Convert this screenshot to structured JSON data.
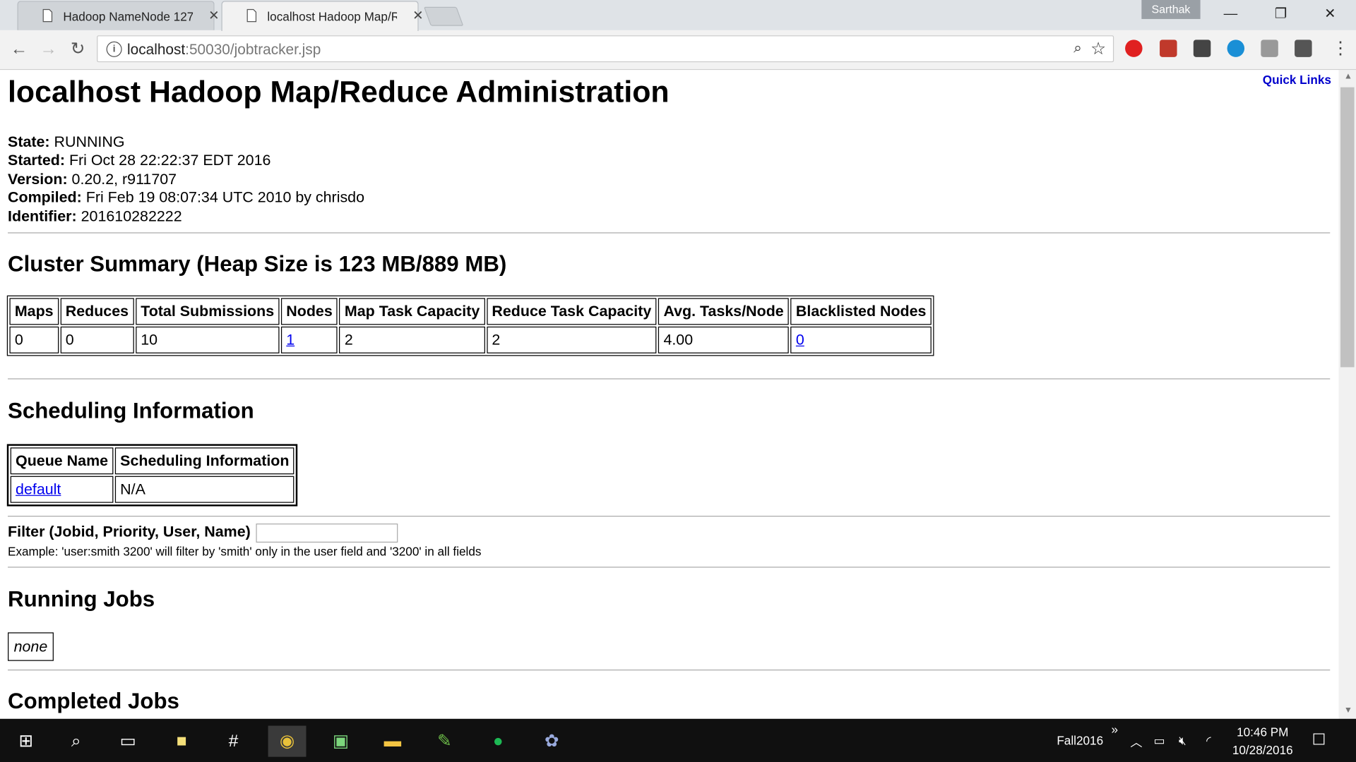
{
  "browser": {
    "tabs": [
      {
        "title": "Hadoop NameNode 127",
        "active": false
      },
      {
        "title": "localhost Hadoop Map/R",
        "active": true
      }
    ],
    "profile": "Sarthak",
    "url_host": "localhost",
    "url_rest": ":50030/jobtracker.jsp",
    "extensions": [
      "opera-icon",
      "pdf-icon",
      "pocket-icon",
      "circle-icon",
      "square-icon",
      "mail-icon"
    ]
  },
  "page": {
    "title": "localhost Hadoop Map/Reduce Administration",
    "quick_links": "Quick Links",
    "info": [
      {
        "label": "State:",
        "value": " RUNNING"
      },
      {
        "label": "Started:",
        "value": " Fri Oct 28 22:22:37 EDT 2016"
      },
      {
        "label": "Version:",
        "value": " 0.20.2, r911707"
      },
      {
        "label": "Compiled:",
        "value": " Fri Feb 19 08:07:34 UTC 2010 by chrisdo"
      },
      {
        "label": "Identifier:",
        "value": " 201610282222"
      }
    ],
    "cluster_heading": "Cluster Summary (Heap Size is 123 MB/889 MB)",
    "cluster_table": {
      "headers": [
        "Maps",
        "Reduces",
        "Total Submissions",
        "Nodes",
        "Map Task Capacity",
        "Reduce Task Capacity",
        "Avg. Tasks/Node",
        "Blacklisted Nodes"
      ],
      "row": [
        "0",
        "0",
        "10",
        "1",
        "2",
        "2",
        "4.00",
        "0"
      ]
    },
    "scheduling_heading": "Scheduling Information",
    "scheduling_table": {
      "headers": [
        "Queue Name",
        "Scheduling Information"
      ],
      "row": [
        "default",
        "N/A"
      ]
    },
    "filter_label": "Filter (Jobid, Priority, User, Name)",
    "filter_value": "",
    "filter_example": "Example: 'user:smith 3200' will filter by 'smith' only in the user field and '3200' in all fields",
    "running_heading": "Running Jobs",
    "running_none": "none",
    "completed_heading": "Completed Jobs"
  },
  "taskbar": {
    "tray_label": "Fall2016",
    "time": "10:46 PM",
    "date": "10/28/2016"
  }
}
